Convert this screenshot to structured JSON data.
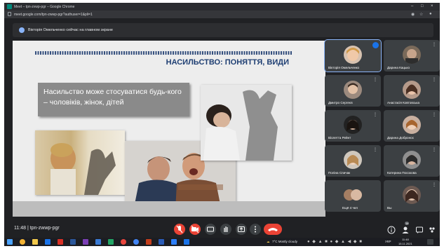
{
  "browser": {
    "window_title": "Meet – tpn-zvwp-pgr – Google Chrome",
    "url": "meet.google.com/tpn-zwwp-pgr?authuser=1&pli=1"
  },
  "banner": {
    "text": "Вікторія Омельченко сейчас на главном экране"
  },
  "slide": {
    "title": "НАСИЛЬСТВО: ПОНЯТТЯ, ВИДИ",
    "box_text": "Насильство може стосуватися будь-кого – чоловіків, жінок, дітей"
  },
  "participants": [
    {
      "name": "Вікторія Омельченко",
      "speaking": true
    },
    {
      "name": "Дарина Кацько"
    },
    {
      "name": "Дмитро Сергеєв"
    },
    {
      "name": "Анастасія Ковтовська"
    },
    {
      "name": "Віолетта Рейнт"
    },
    {
      "name": "Дарина Добронос"
    },
    {
      "name": "Поліна Спичак"
    },
    {
      "name": "Катерина Посохова"
    },
    {
      "name": "Ещё 4 чел"
    },
    {
      "name": "Вы"
    }
  ],
  "bottom_bar": {
    "clock": "11:48",
    "meeting_code": "tpn-zwwp-pgr",
    "people_count": "14"
  },
  "taskbar": {
    "weather": "7°C Mostly cloudy",
    "lang": "УКР",
    "time": "11:48",
    "date": "15.11.2021"
  }
}
